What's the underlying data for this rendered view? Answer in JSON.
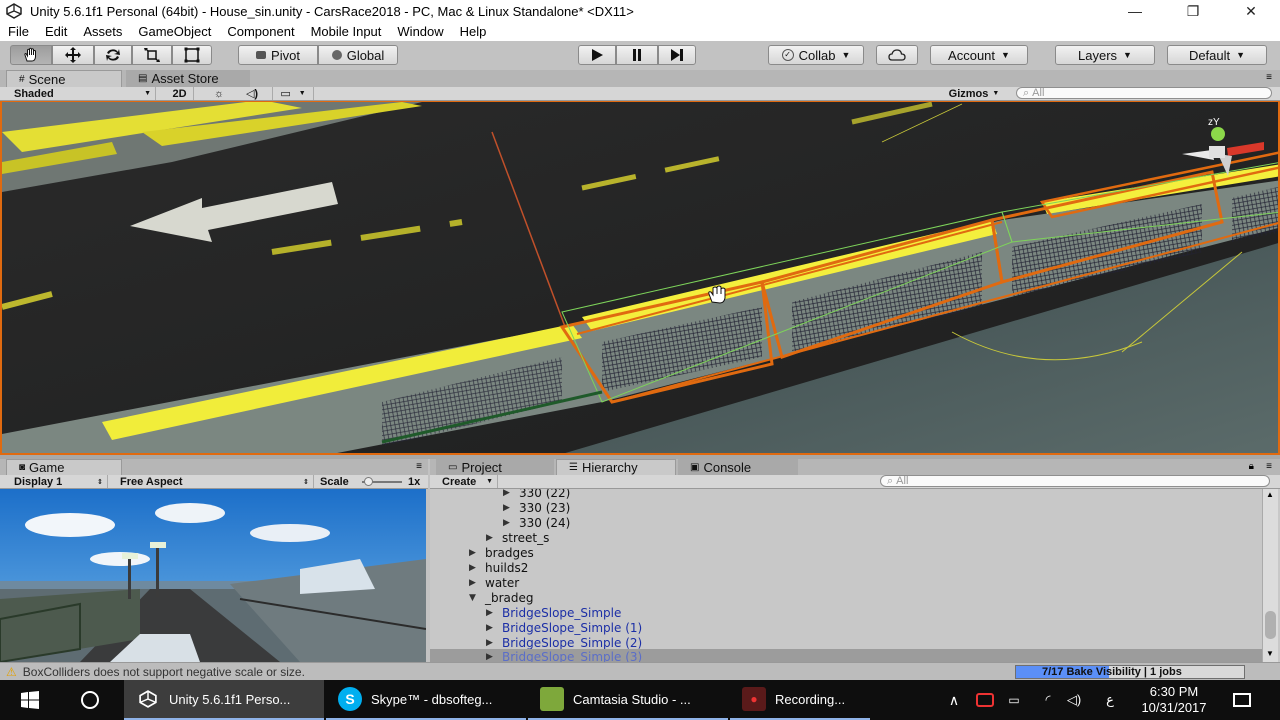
{
  "window": {
    "title": "Unity 5.6.1f1 Personal (64bit) - House_sin.unity - CarsRace2018 - PC, Mac & Linux Standalone* <DX11>",
    "minimize": "—",
    "maximize": "❐",
    "close": "✕"
  },
  "menu": [
    "File",
    "Edit",
    "Assets",
    "GameObject",
    "Component",
    "Mobile Input",
    "Window",
    "Help"
  ],
  "toolbar": {
    "pivot": "Pivot",
    "global": "Global",
    "collab": "Collab",
    "account": "Account",
    "layers": "Layers",
    "layout": "Default"
  },
  "scene": {
    "tab_scene": "Scene",
    "tab_asset_store": "Asset Store",
    "shading": "Shaded",
    "mode_2d": "2D",
    "gizmos": "Gizmos",
    "search_placeholder": "All",
    "gizmo_axes": "zY"
  },
  "game": {
    "tab": "Game",
    "display": "Display 1",
    "aspect": "Free Aspect",
    "scale_label": "Scale",
    "scale_value": "1x"
  },
  "panels": {
    "project_tab": "Project",
    "hierarchy_tab": "Hierarchy",
    "console_tab": "Console",
    "create_label": "Create",
    "search_placeholder": "All"
  },
  "hierarchy": [
    {
      "label": "330 (22)",
      "indent": 3,
      "arrow": "▶",
      "type": "normal"
    },
    {
      "label": "330 (23)",
      "indent": 3,
      "arrow": "▶",
      "type": "normal"
    },
    {
      "label": "330 (24)",
      "indent": 3,
      "arrow": "▶",
      "type": "normal"
    },
    {
      "label": "street_s",
      "indent": 2,
      "arrow": "▶",
      "type": "normal"
    },
    {
      "label": "bradges",
      "indent": 1,
      "arrow": "▶",
      "type": "normal"
    },
    {
      "label": "huilds2",
      "indent": 1,
      "arrow": "▶",
      "type": "normal"
    },
    {
      "label": "water",
      "indent": 1,
      "arrow": "▶",
      "type": "normal"
    },
    {
      "label": "_bradeg",
      "indent": 1,
      "arrow": "▼",
      "type": "normal"
    },
    {
      "label": "BridgeSlope_Simple",
      "indent": 2,
      "arrow": "▶",
      "type": "prefab"
    },
    {
      "label": "BridgeSlope_Simple (1)",
      "indent": 2,
      "arrow": "▶",
      "type": "prefab"
    },
    {
      "label": "BridgeSlope_Simple (2)",
      "indent": 2,
      "arrow": "▶",
      "type": "prefab"
    },
    {
      "label": "BridgeSlope_Simple (3)",
      "indent": 2,
      "arrow": "▶",
      "type": "selected"
    }
  ],
  "status": {
    "warning": "BoxColliders does not support negative scale or size.",
    "bake": "7/17 Bake Visibility | 1 jobs",
    "bake_progress": 0.41
  },
  "taskbar": {
    "items": [
      {
        "label": "Unity 5.6.1f1 Perso...",
        "icon": "unity-icon"
      },
      {
        "label": "Skype™ - dbsofteg...",
        "icon": "skype-icon"
      },
      {
        "label": "Camtasia Studio - ...",
        "icon": "camtasia-icon"
      },
      {
        "label": "Recording...",
        "icon": "recording-icon"
      }
    ],
    "ime": "ع",
    "time": "6:30 PM",
    "date": "10/31/2017"
  },
  "colors": {
    "selection_orange": "#e06a10",
    "prefab_blue": "#1c2fa6",
    "bake_blue": "#5b8ff7",
    "unity_panel": "#c2c2c2"
  }
}
